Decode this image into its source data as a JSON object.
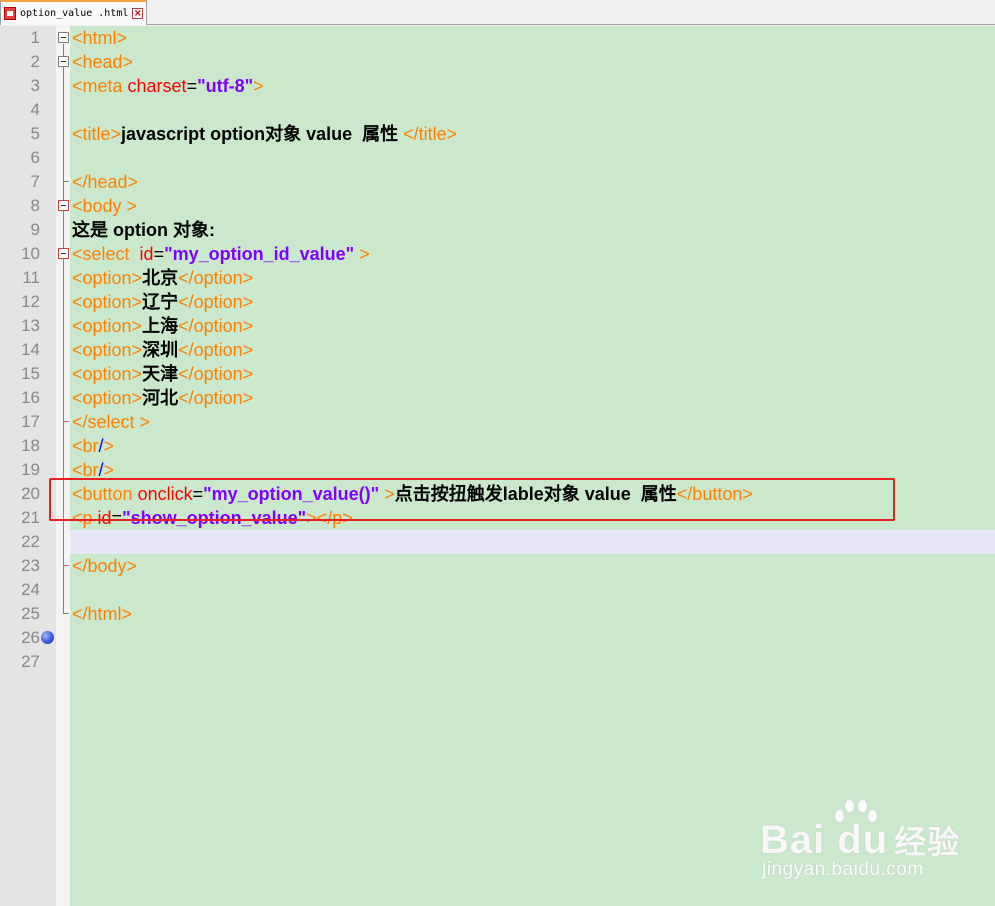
{
  "tab": {
    "filename": "option_value .html",
    "close_label": "×"
  },
  "line_numbers": [
    "1",
    "2",
    "3",
    "4",
    "5",
    "6",
    "7",
    "8",
    "9",
    "10",
    "11",
    "12",
    "13",
    "14",
    "15",
    "16",
    "17",
    "18",
    "19",
    "20",
    "21",
    "22",
    "23",
    "24",
    "25",
    "26",
    "27"
  ],
  "code": {
    "l1": {
      "tag": "<html>"
    },
    "l2": {
      "tag": "<head>"
    },
    "l3": {
      "open": "<meta ",
      "attr": "charset",
      "eq": "=",
      "val": "\"utf-8\"",
      "close": ">"
    },
    "l5": {
      "open": "<title>",
      "text": "javascript option对象 value  属性 ",
      "close": "</title>"
    },
    "l7": {
      "tag": "</head>"
    },
    "l8": {
      "tag": "<body >"
    },
    "l9": {
      "text": "这是 option 对象:"
    },
    "l10": {
      "open": "<select  ",
      "attr": "id",
      "eq": "=",
      "val": "\"my_option_id_value\"",
      "close": " >"
    },
    "l11": {
      "open": "<option>",
      "text": "北京",
      "close": "</option>"
    },
    "l12": {
      "open": "<option>",
      "text": "辽宁",
      "close": "</option>"
    },
    "l13": {
      "open": "<option>",
      "text": "上海",
      "close": "</option>"
    },
    "l14": {
      "open": "<option>",
      "text": "深圳",
      "close": "</option>"
    },
    "l15": {
      "open": "<option>",
      "text": "天津",
      "close": "</option>"
    },
    "l16": {
      "open": "<option>",
      "text": "河北",
      "close": "</option>"
    },
    "l17": {
      "tag": "</select >"
    },
    "l18": {
      "open": "<br",
      "slash": "/",
      "close": ">"
    },
    "l19": {
      "open": "<br",
      "slash": "/",
      "close": ">"
    },
    "l20": {
      "open": "<button ",
      "attr": "onclick",
      "eq": "=",
      "val": "\"my_option_value()\"",
      "mid": " >",
      "text": "点击按扭触发lable对象 value  属性",
      "close": "</button>"
    },
    "l21": {
      "open": "<p ",
      "attr": "id",
      "eq": "=",
      "val": "\"show_option_value\"",
      "mid": "></p>"
    },
    "l23": {
      "tag": "</body>"
    },
    "l25": {
      "tag": "</html>"
    }
  },
  "watermark": {
    "brand": "Bai du",
    "cn": "经验",
    "url": "jingyan.baidu.com"
  },
  "colors": {
    "code_bg": "#cae9cc",
    "tag": "#ff8000",
    "attr": "#ff0000",
    "value": "#8000ff",
    "highlight": "#e82020"
  }
}
